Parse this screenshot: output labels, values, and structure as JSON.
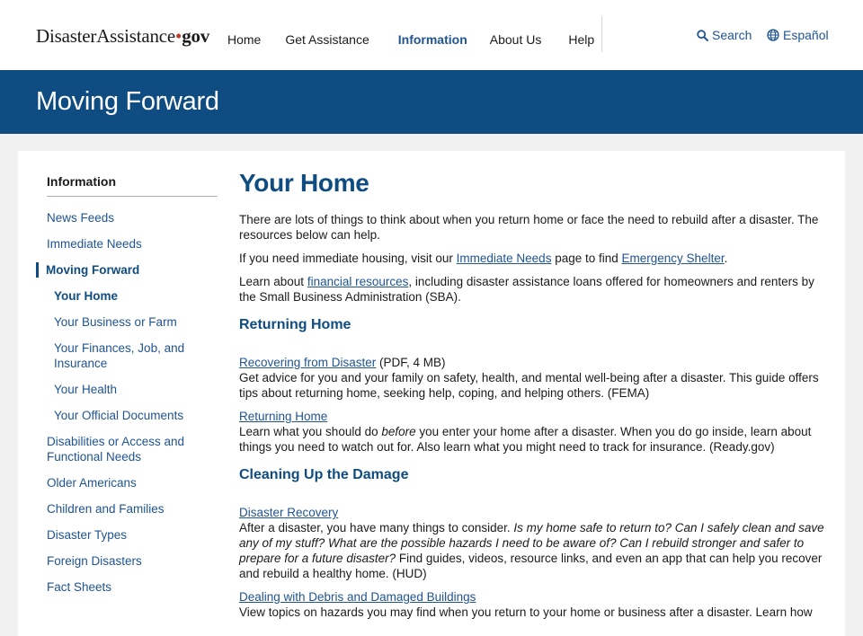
{
  "logo": {
    "part1": "Disaster",
    "part2": "Assistance",
    "dot": "•",
    "gov": "gov"
  },
  "nav": {
    "home": "Home",
    "get_assistance": "Get Assistance",
    "information": "Information",
    "about": "About Us",
    "help": "Help"
  },
  "utility": {
    "search": "Search",
    "language": "Español"
  },
  "banner": {
    "title": "Moving Forward"
  },
  "sidebar": {
    "heading": "Information",
    "items": {
      "news": "News Feeds",
      "immediate": "Immediate Needs",
      "moving": "Moving Forward",
      "your_home": "Your Home",
      "business": "Your Business or Farm",
      "finances": "Your Finances, Job, and Insurance",
      "health": "Your Health",
      "documents": "Your Official Documents",
      "disabilities": "Disabilities or Access and Functional Needs",
      "older": "Older Americans",
      "children": "Children and Families",
      "types": "Disaster Types",
      "foreign": "Foreign Disasters",
      "facts": "Fact Sheets"
    }
  },
  "main": {
    "title": "Your Home",
    "intro": "There are lots of things to think about when you return home or face the need to rebuild after a disaster. The resources below can help.",
    "p2": {
      "a": "If you need immediate housing, visit our ",
      "link1": "Immediate Needs",
      "b": " page to find ",
      "link2": "Emergency Shelter",
      "c": "."
    },
    "p3": {
      "a": "Learn about ",
      "link": "financial resources",
      "b": ", including disaster assistance loans offered for homeowners and renters by the Small Business Administration (SBA)."
    },
    "section1": {
      "heading": "Returning Home",
      "r1": {
        "link": "Recovering from Disaster",
        "meta": " (PDF, 4 MB)",
        "desc": "Get advice for you and your family on safety, health, and mental well-being after a disaster. This guide offers tips about returning home, seeking help, coping, and helping others. (FEMA)"
      },
      "r2": {
        "link": "Returning Home ",
        "desc_a": "Learn what you should do ",
        "desc_em": "before",
        "desc_b": " you enter your home after a disaster. When you do go inside, learn about things you need to watch out for. Also learn what you might need to track for insurance. (Ready.gov)"
      }
    },
    "section2": {
      "heading": "Cleaning Up the Damage",
      "r1": {
        "link": "Disaster Recovery",
        "desc_a": "After a disaster, you have many things to consider. ",
        "desc_em": "Is my home safe to return to? Can I safely clean and save any of my stuff? What are the possible hazards I need to be aware of? Can I rebuild stronger and safer to prepare for a future disaster?",
        "desc_b": " Find guides, videos, resource links, and even an app that can help you recover and rebuild a healthy home. (HUD)"
      },
      "r2": {
        "link": "Dealing with Debris and Damaged Buildings",
        "desc": "View topics on hazards you may find when you return to your home or business after a disaster. Learn how"
      }
    }
  },
  "colors": {
    "primary": "#0e4c81",
    "link": "#205493",
    "accent_red": "#c0392b"
  },
  "icons": {
    "search": "search-icon",
    "language": "globe-icon"
  }
}
